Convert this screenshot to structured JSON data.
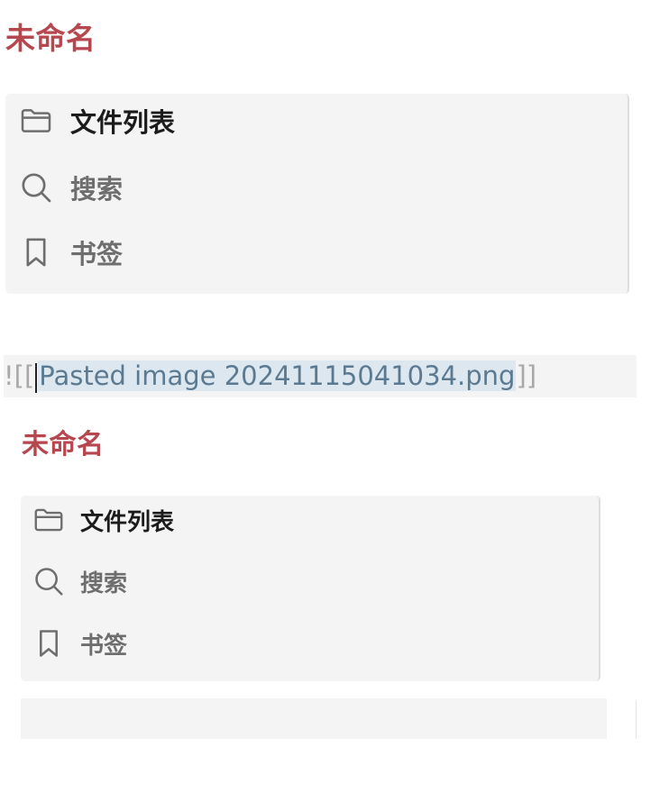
{
  "note_title": "未命名",
  "nav": {
    "items": [
      {
        "label": "文件列表",
        "icon": "folder-icon",
        "active": true
      },
      {
        "label": "搜索",
        "icon": "search-icon",
        "active": false
      },
      {
        "label": "书签",
        "icon": "bookmark-icon",
        "active": false
      }
    ]
  },
  "editor": {
    "embed_prefix": "![[",
    "embed_filename": "Pasted image 20241115041034.png",
    "embed_suffix": "]]"
  },
  "colors": {
    "title": "#b7474f",
    "panel_bg": "#f4f4f4",
    "link_highlight": "#dde7ef",
    "link_text": "#5b7a91"
  }
}
